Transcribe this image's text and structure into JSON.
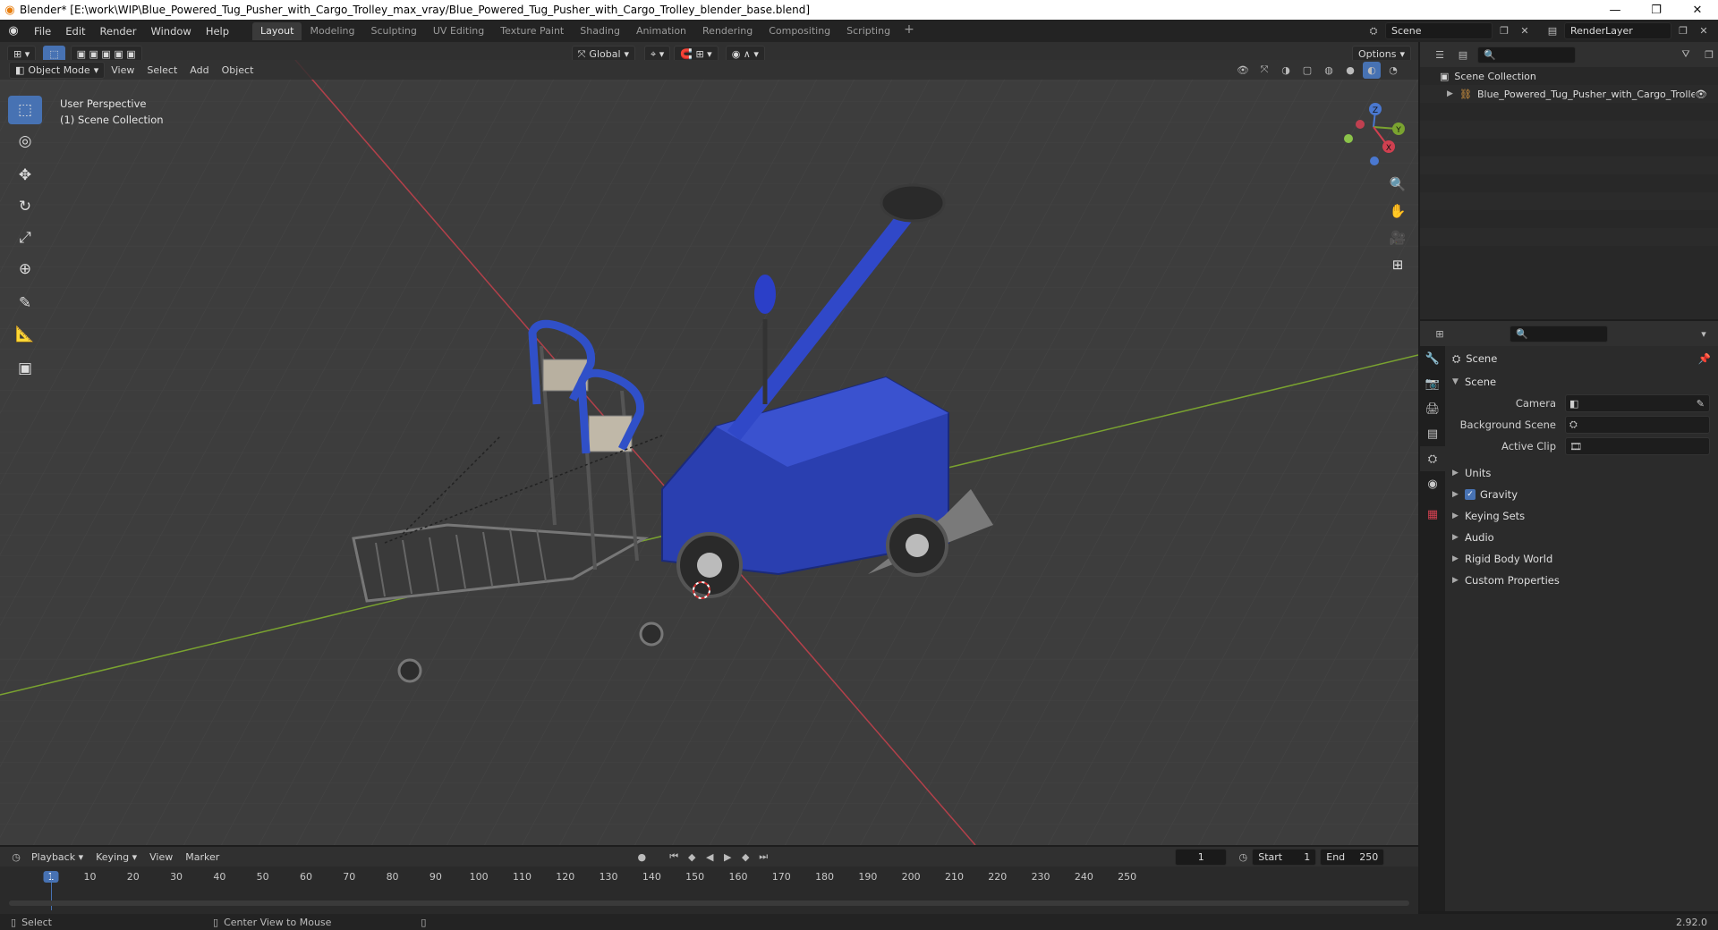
{
  "window": {
    "title": "Blender* [E:\\work\\WIP\\Blue_Powered_Tug_Pusher_with_Cargo_Trolley_max_vray/Blue_Powered_Tug_Pusher_with_Cargo_Trolley_blender_base.blend]",
    "minimize": "—",
    "restore": "❐",
    "close": "✕"
  },
  "menu": [
    "File",
    "Edit",
    "Render",
    "Window",
    "Help"
  ],
  "workspaces": [
    "Layout",
    "Modeling",
    "Sculpting",
    "UV Editing",
    "Texture Paint",
    "Shading",
    "Animation",
    "Rendering",
    "Compositing",
    "Scripting"
  ],
  "active_workspace": "Layout",
  "scene_name": "Scene",
  "render_layer": "RenderLayer",
  "viewport": {
    "mode": "Object Mode",
    "menus": [
      "View",
      "Select",
      "Add",
      "Object"
    ],
    "transform_orientation": "Global",
    "options_label": "Options",
    "overlay_line1": "User Perspective",
    "overlay_line2": "(1) Scene Collection",
    "gizmo_labels": {
      "z": "Z",
      "y": "Y",
      "x": "X"
    }
  },
  "outliner": {
    "root": "Scene Collection",
    "items": [
      "Blue_Powered_Tug_Pusher_with_Cargo_Trolle"
    ]
  },
  "properties": {
    "context": "Scene",
    "section": "Scene",
    "fields": [
      {
        "label": "Camera",
        "value": ""
      },
      {
        "label": "Background Scene",
        "value": ""
      },
      {
        "label": "Active Clip",
        "value": ""
      }
    ],
    "panels": [
      "Units",
      "Gravity",
      "Keying Sets",
      "Audio",
      "Rigid Body World",
      "Custom Properties"
    ],
    "gravity_checked": true
  },
  "timeline": {
    "menus": [
      "Playback",
      "Keying",
      "View",
      "Marker"
    ],
    "current_frame": "1",
    "start_label": "Start",
    "start": "1",
    "end_label": "End",
    "end": "250",
    "ruler": [
      "1",
      "10",
      "20",
      "30",
      "40",
      "50",
      "60",
      "70",
      "80",
      "90",
      "100",
      "110",
      "120",
      "130",
      "140",
      "150",
      "160",
      "170",
      "180",
      "190",
      "200",
      "210",
      "220",
      "230",
      "240",
      "250"
    ]
  },
  "statusbar": {
    "left": "Select",
    "middle": "Center View to Mouse",
    "version": "2.92.0"
  },
  "colors": {
    "accent": "#4772b3",
    "x_axis": "#b3404a",
    "y_axis": "#7aa330",
    "tug_blue": "#2a3fb0"
  }
}
